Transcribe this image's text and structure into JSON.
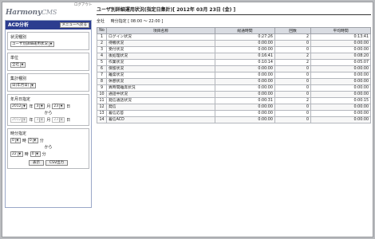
{
  "header": {
    "logout_label": "ログアウト",
    "logo_main": "Harmony",
    "logo_suffix": "CMS"
  },
  "sidebar": {
    "title": "ACD分析",
    "menu_back_label": "メニューへ戻る",
    "status_type": {
      "label": "状況種別",
      "value": "ユーザ別詳細運用状況"
    },
    "unit": {
      "label": "単位",
      "value": "全社"
    },
    "aggregation": {
      "label": "集計種別",
      "value": "日(年月日)"
    },
    "date": {
      "label": "年月日指定",
      "from": {
        "year": "2012",
        "year_unit": "年",
        "month": "3",
        "month_unit": "月",
        "day": "23",
        "day_unit": "日"
      },
      "to_word": "から",
      "to": {
        "year": "2012",
        "year_unit": "年",
        "month": "3",
        "month_unit": "月",
        "day": "23",
        "day_unit": "日"
      }
    },
    "time": {
      "label": "時分指定",
      "from": {
        "hour": "0",
        "hour_unit": "時",
        "minute": "0",
        "minute_unit": "分"
      },
      "to_word": "から",
      "to": {
        "hour": "22",
        "hour_unit": "時",
        "minute": "0",
        "minute_unit": "分"
      }
    },
    "display_button": "表示",
    "csv_button": "CSV出力"
  },
  "main": {
    "title": "ユーザ別詳細運用状況(指定日集計)[ 2012年 03月 23日 (金) ]",
    "unit_text": "全社",
    "time_range_text": "時分指定 [ 08:00 ～ 22:00 ]",
    "table": {
      "headers": [
        "No",
        "項目名称",
        "総通時間",
        "回数",
        "平均時間"
      ],
      "rows": [
        [
          "1",
          "ログイン状況",
          "0:27:26",
          "2",
          "0:13:41"
        ],
        [
          "2",
          "待機状況",
          "0:00:00",
          "0",
          "0:00:00"
        ],
        [
          "3",
          "受付状況",
          "0:00:00",
          "0",
          "0:00:00"
        ],
        [
          "4",
          "後処理状況",
          "0:16:41",
          "2",
          "0:08:20"
        ],
        [
          "5",
          "作業状況",
          "0:10:14",
          "2",
          "0:05:07"
        ],
        [
          "6",
          "保留状況",
          "0:00:00",
          "0",
          "0:00:00"
        ],
        [
          "7",
          "離席状況",
          "0:00:00",
          "0",
          "0:00:00"
        ],
        [
          "8",
          "休憩状況",
          "0:00:00",
          "0",
          "0:00:00"
        ],
        [
          "9",
          "異時間離席状況",
          "0:00:00",
          "0",
          "0:00:00"
        ],
        [
          "10",
          "通話中状況",
          "0:00:00",
          "0",
          "0:00:00"
        ],
        [
          "11",
          "発信通話状況",
          "0:00:31",
          "2",
          "0:00:15"
        ],
        [
          "12",
          "発信",
          "0:00:00",
          "0",
          "0:00:00"
        ],
        [
          "13",
          "着信応答",
          "0:00:00",
          "0",
          "0:00:00"
        ],
        [
          "14",
          "着信ACD",
          "0:00:00",
          "0",
          "0:00:00"
        ]
      ]
    }
  }
}
